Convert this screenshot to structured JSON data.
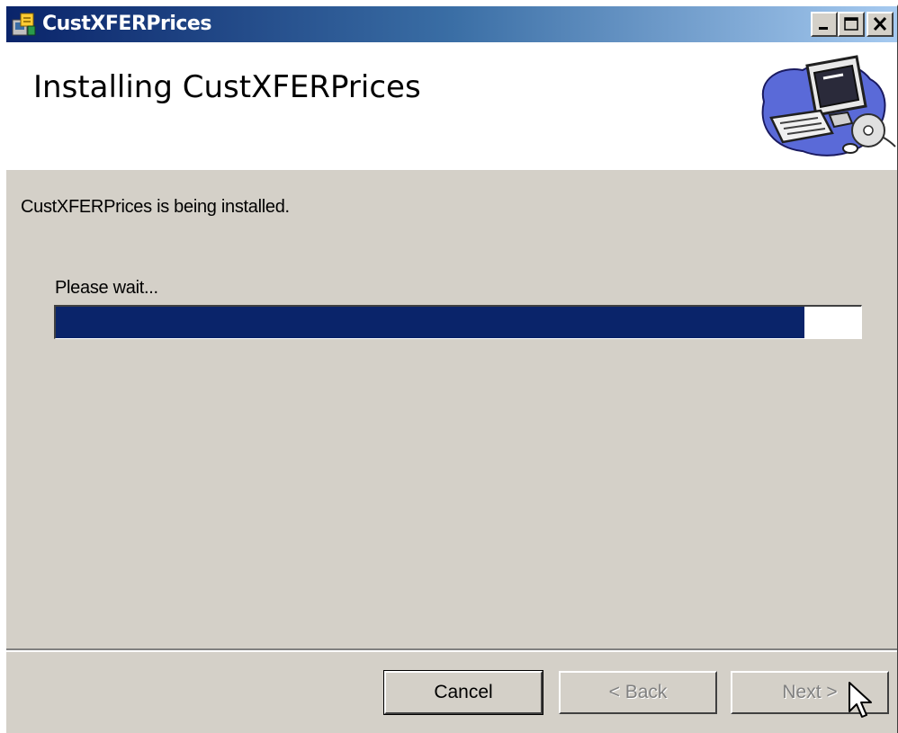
{
  "window": {
    "title": "CustXFERPrices",
    "controls": {
      "minimize_icon": "minimize-icon",
      "maximize_icon": "maximize-icon",
      "close_icon": "close-icon"
    }
  },
  "header": {
    "title": "Installing CustXFERPrices",
    "graphic_icon": "computer-installer-icon"
  },
  "main": {
    "status_text": "CustXFERPrices is being installed.",
    "wait_text": "Please wait...",
    "progress_percent": 93
  },
  "buttons": {
    "cancel_label": "Cancel",
    "back_label": "< Back",
    "next_label": "Next >"
  },
  "colors": {
    "progress_fill": "#0a246a",
    "titlebar_start": "#0a246a",
    "titlebar_end": "#a6caf0"
  }
}
